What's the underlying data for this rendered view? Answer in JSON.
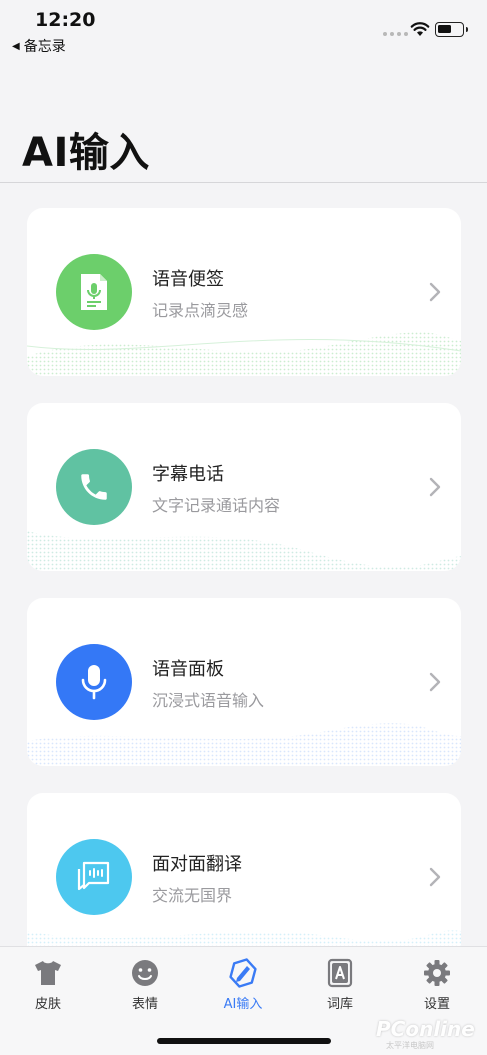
{
  "status_bar": {
    "time": "12:20",
    "back_app": "备忘录"
  },
  "header": {
    "title": "AI输入"
  },
  "cards": [
    {
      "title": "语音便签",
      "subtitle": "记录点滴灵感",
      "icon": "voice-note-icon",
      "color": "#6ccf6b"
    },
    {
      "title": "字幕电话",
      "subtitle": "文字记录通话内容",
      "icon": "phone-icon",
      "color": "#60c2a2"
    },
    {
      "title": "语音面板",
      "subtitle": "沉浸式语音输入",
      "icon": "microphone-icon",
      "color": "#3478f6"
    },
    {
      "title": "面对面翻译",
      "subtitle": "交流无国界",
      "icon": "translate-chat-icon",
      "color": "#4dc8ef"
    }
  ],
  "tabs": [
    {
      "label": "皮肤",
      "icon": "skin-shirt-icon",
      "active": false
    },
    {
      "label": "表情",
      "icon": "emoji-face-icon",
      "active": false
    },
    {
      "label": "AI输入",
      "icon": "ai-input-icon",
      "active": true
    },
    {
      "label": "词库",
      "icon": "lexicon-icon",
      "active": false
    },
    {
      "label": "设置",
      "icon": "settings-gear-icon",
      "active": false
    }
  ],
  "watermark": {
    "text": "PConline",
    "sub": "太平洋电脑网"
  },
  "colors": {
    "accent": "#3a7bf5",
    "background": "#f4f4f6"
  }
}
